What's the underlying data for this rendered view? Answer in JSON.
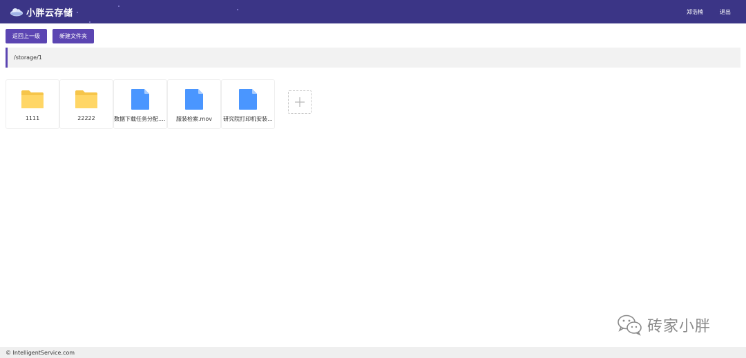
{
  "header": {
    "brand_title": "小胖云存储",
    "user_name": "郑浩楠",
    "logout_label": "退出"
  },
  "toolbar": {
    "back_label": "返回上一级",
    "new_folder_label": "新建文件夹"
  },
  "path": "/storage/1",
  "files": [
    {
      "name": "1111",
      "type": "folder"
    },
    {
      "name": "22222",
      "type": "folder"
    },
    {
      "name": "数据下载任务分配.zip",
      "type": "file"
    },
    {
      "name": "服装检索.mov",
      "type": "file"
    },
    {
      "name": "研究院打印机安装...",
      "type": "file"
    }
  ],
  "watermark": "砖家小胖",
  "footer": "© IntelligentService.com",
  "colors": {
    "header_bg": "#3b3586",
    "accent": "#5b45b2",
    "folder": "#ffd666",
    "file": "#4a96ff"
  }
}
